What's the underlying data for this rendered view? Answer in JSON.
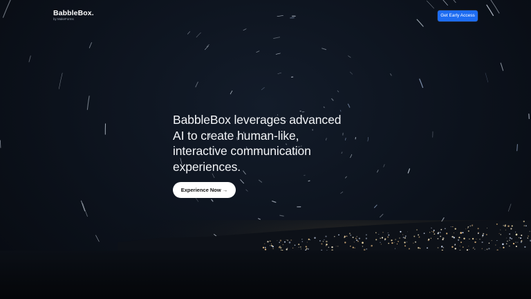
{
  "header": {
    "brand_name": "BabbleBox.",
    "brand_subtitle": "by MakeForms",
    "cta_label": "Get Early Access"
  },
  "hero": {
    "headline_lines": [
      "BabbleBox leverages advanced",
      "AI to create human-like,",
      "interactive communication",
      "experiences."
    ],
    "cta_label": "Experience Now →"
  },
  "colors": {
    "background": "#0c121c",
    "primary_button": "#1d6cf2",
    "secondary_button": "#ffffff",
    "text": "#f2f4f7"
  }
}
